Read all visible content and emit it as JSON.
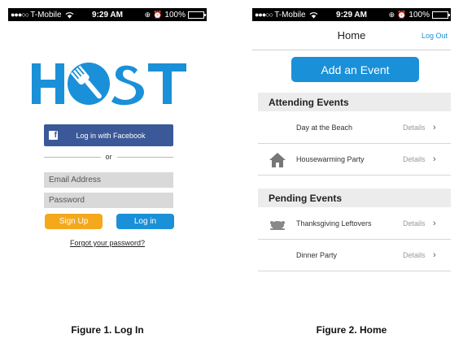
{
  "status_bar": {
    "signal_dots": "●●●○○",
    "carrier": "T-Mobile",
    "time": "9:29 AM",
    "battery": "100%"
  },
  "login": {
    "logo_text": "HOST",
    "facebook_button": "Log in with Facebook",
    "facebook_glyph": "f",
    "or_text": "or",
    "email_placeholder": "Email Address",
    "password_placeholder": "Password",
    "signup_button": "Sign Up",
    "login_button": "Log in",
    "forgot_link": "Forgot your password?",
    "caption": "Figure 1. Log In"
  },
  "home": {
    "title": "Home",
    "logout_link": "Log Out",
    "add_event_button": "Add an Event",
    "attending_header": "Attending Events",
    "attending": [
      {
        "name": "Day at the Beach",
        "details": "Details",
        "icon": ""
      },
      {
        "name": "Housewarming Party",
        "details": "Details",
        "icon": "house-icon"
      }
    ],
    "pending_header": "Pending Events",
    "pending": [
      {
        "name": "Thanksgiving Leftovers",
        "details": "Details",
        "icon": "turkey-icon"
      },
      {
        "name": "Dinner Party",
        "details": "Details",
        "icon": ""
      }
    ],
    "caption": "Figure 2. Home"
  },
  "colors": {
    "accent_blue": "#1a90d8",
    "signup_orange": "#f5a81c",
    "facebook_blue": "#3b5998"
  }
}
